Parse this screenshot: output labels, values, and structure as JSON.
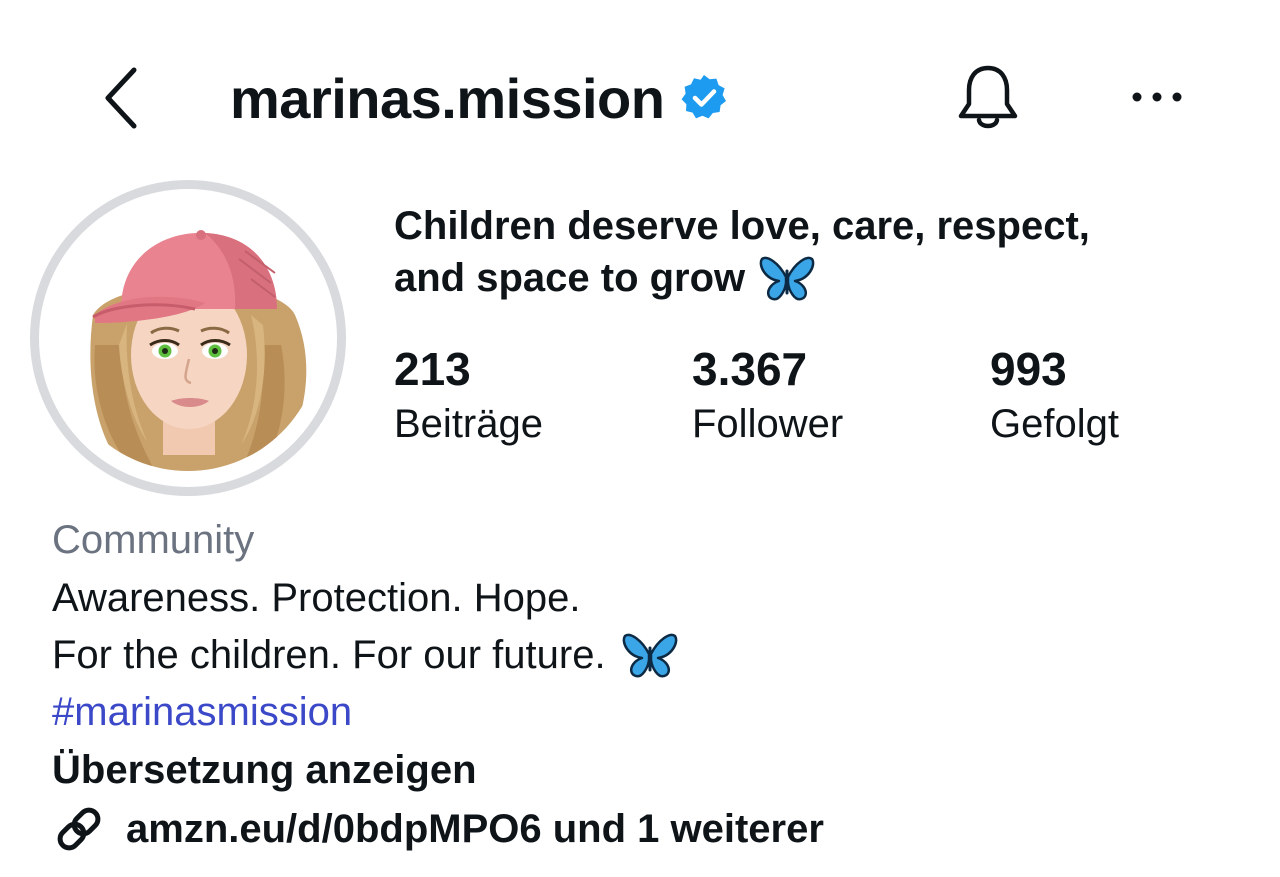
{
  "header": {
    "username": "marinas.mission",
    "verified": true,
    "back_icon": "chevron-left-icon",
    "bell_icon": "bell-icon",
    "more_icon": "more-horizontal-icon",
    "verified_color": "#1d9bf0"
  },
  "profile": {
    "tagline_line1": "Children deserve love, care, respect,",
    "tagline_line2": "and space to grow",
    "tagline_emoji": "butterfly-emoji",
    "stats": [
      {
        "value": "213",
        "label": "Beiträge"
      },
      {
        "value": "3.367",
        "label": "Follower"
      },
      {
        "value": "993",
        "label": "Gefolgt"
      }
    ]
  },
  "bio": {
    "category": "Community",
    "line1": "Awareness. Protection. Hope.",
    "line2": "For the children. For our future.",
    "hashtag": "#marinasmission",
    "translate_label": "Übersetzung anzeigen",
    "link_text": "amzn.eu/d/0bdpMPO6 und 1 weiterer",
    "link_icon": "link-icon"
  },
  "colors": {
    "text": "#0f1419",
    "category": "#6b7280",
    "hashtag": "#3b48c8",
    "avatar_ring": "#d8dade",
    "butterfly": "#3aa6e8"
  }
}
